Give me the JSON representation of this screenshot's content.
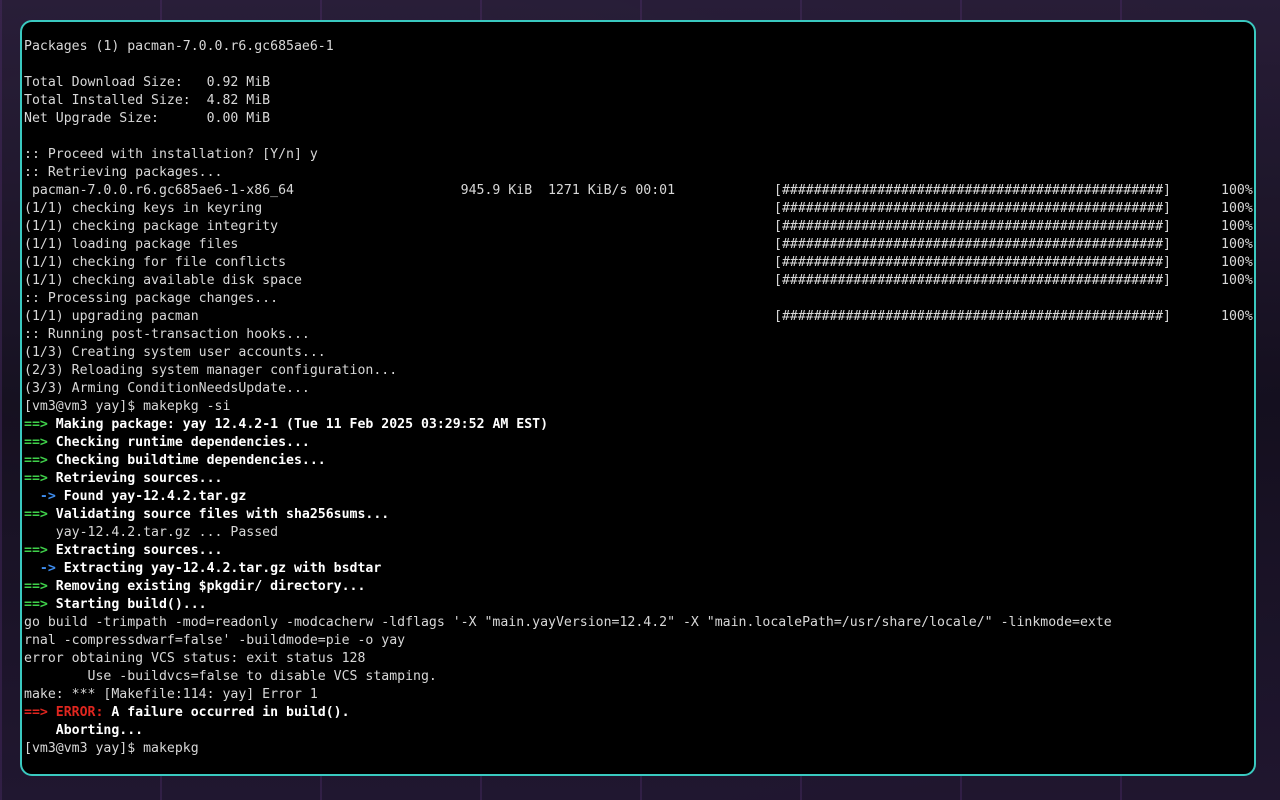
{
  "colors": {
    "border": "#3ac9c0",
    "arrow_green": "#3fd14a",
    "arrow_blue": "#3e8df0",
    "error_red": "#e0261f"
  },
  "lines": [
    {
      "type": "plain",
      "text": "Packages (1) pacman-7.0.0.r6.gc685ae6-1"
    },
    {
      "type": "plain",
      "text": ""
    },
    {
      "type": "plain",
      "text": "Total Download Size:   0.92 MiB"
    },
    {
      "type": "plain",
      "text": "Total Installed Size:  4.82 MiB"
    },
    {
      "type": "plain",
      "text": "Net Upgrade Size:      0.00 MiB"
    },
    {
      "type": "plain",
      "text": ""
    },
    {
      "type": "plain",
      "text": ":: Proceed with installation? [Y/n] y"
    },
    {
      "type": "plain",
      "text": ":: Retrieving packages..."
    },
    {
      "type": "progress",
      "text": " pacman-7.0.0.r6.gc685ae6-1-x86_64                     945.9 KiB  1271 KiB/s 00:01",
      "bar": "[################################################]",
      "pct": "100%"
    },
    {
      "type": "progress",
      "text": "(1/1) checking keys in keyring",
      "bar": "[################################################]",
      "pct": "100%"
    },
    {
      "type": "progress",
      "text": "(1/1) checking package integrity",
      "bar": "[################################################]",
      "pct": "100%"
    },
    {
      "type": "progress",
      "text": "(1/1) loading package files",
      "bar": "[################################################]",
      "pct": "100%"
    },
    {
      "type": "progress",
      "text": "(1/1) checking for file conflicts",
      "bar": "[################################################]",
      "pct": "100%"
    },
    {
      "type": "progress",
      "text": "(1/1) checking available disk space",
      "bar": "[################################################]",
      "pct": "100%"
    },
    {
      "type": "plain",
      "text": ":: Processing package changes..."
    },
    {
      "type": "progress",
      "text": "(1/1) upgrading pacman",
      "bar": "[################################################]",
      "pct": "100%"
    },
    {
      "type": "plain",
      "text": ":: Running post-transaction hooks..."
    },
    {
      "type": "plain",
      "text": "(1/3) Creating system user accounts..."
    },
    {
      "type": "plain",
      "text": "(2/3) Reloading system manager configuration..."
    },
    {
      "type": "plain",
      "text": "(3/3) Arming ConditionNeedsUpdate..."
    },
    {
      "type": "plain",
      "text": "[vm3@vm3 yay]$ makepkg -si"
    },
    {
      "type": "green",
      "prefix": "==>",
      "text": " Making package: yay 12.4.2-1 (Tue 11 Feb 2025 03:29:52 AM EST)"
    },
    {
      "type": "green",
      "prefix": "==>",
      "text": " Checking runtime dependencies..."
    },
    {
      "type": "green",
      "prefix": "==>",
      "text": " Checking buildtime dependencies..."
    },
    {
      "type": "green",
      "prefix": "==>",
      "text": " Retrieving sources..."
    },
    {
      "type": "blue",
      "prefix": "  ->",
      "text": " Found yay-12.4.2.tar.gz"
    },
    {
      "type": "green",
      "prefix": "==>",
      "text": " Validating source files with sha256sums..."
    },
    {
      "type": "plain",
      "text": "    yay-12.4.2.tar.gz ... Passed"
    },
    {
      "type": "green",
      "prefix": "==>",
      "text": " Extracting sources..."
    },
    {
      "type": "blue",
      "prefix": "  ->",
      "text": " Extracting yay-12.4.2.tar.gz with bsdtar"
    },
    {
      "type": "green",
      "prefix": "==>",
      "text": " Removing existing $pkgdir/ directory..."
    },
    {
      "type": "green",
      "prefix": "==>",
      "text": " Starting build()..."
    },
    {
      "type": "plain",
      "text": "go build -trimpath -mod=readonly -modcacherw -ldflags '-X \"main.yayVersion=12.4.2\" -X \"main.localePath=/usr/share/locale/\" -linkmode=exte"
    },
    {
      "type": "plain",
      "text": "rnal -compressdwarf=false' -buildmode=pie -o yay"
    },
    {
      "type": "plain",
      "text": "error obtaining VCS status: exit status 128"
    },
    {
      "type": "plain",
      "text": "        Use -buildvcs=false to disable VCS stamping."
    },
    {
      "type": "plain",
      "text": "make: *** [Makefile:114: yay] Error 1"
    },
    {
      "type": "error",
      "prefix": "==>",
      "label": " ERROR:",
      "text": " A failure occurred in build()."
    },
    {
      "type": "boldplain",
      "text": "    Aborting..."
    },
    {
      "type": "plain",
      "text": "[vm3@vm3 yay]$ makepkg"
    }
  ]
}
